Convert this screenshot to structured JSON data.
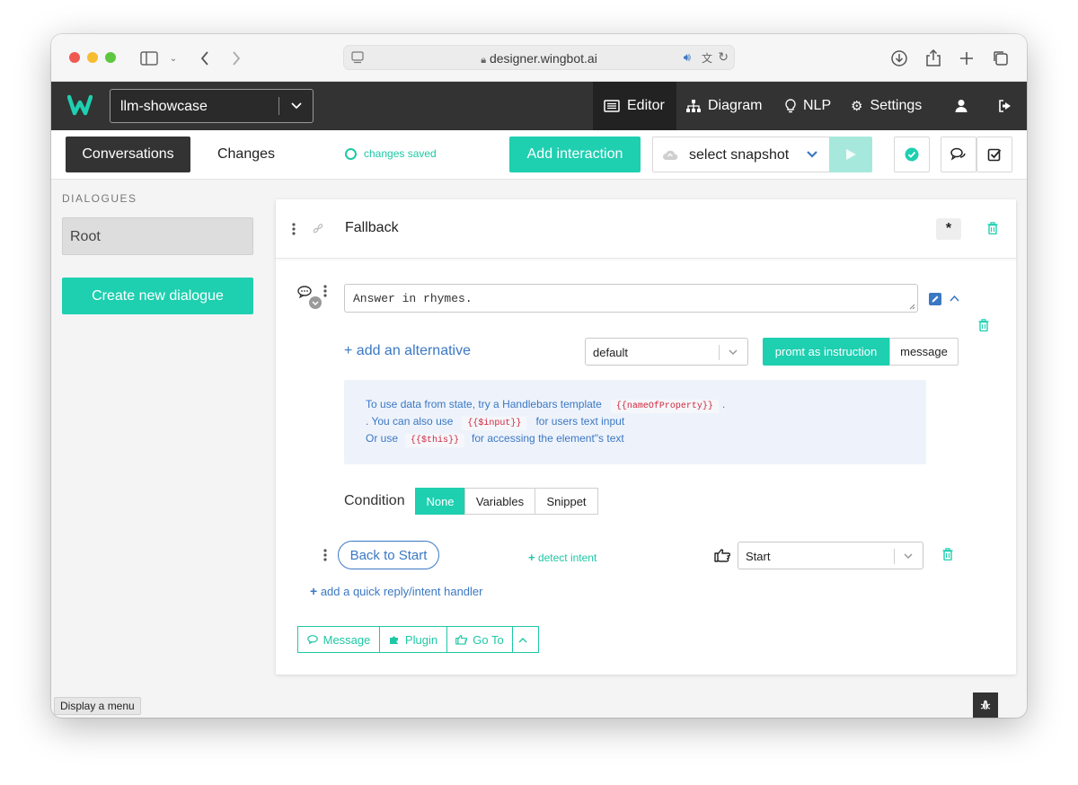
{
  "browser": {
    "url": "designer.wingbot.ai"
  },
  "appbar": {
    "project": "llm-showcase",
    "nav": [
      {
        "label": "Editor",
        "icon": "list-icon",
        "active": true
      },
      {
        "label": "Diagram",
        "icon": "sitemap-icon"
      },
      {
        "label": "NLP",
        "icon": "lightbulb-icon"
      },
      {
        "label": "Settings",
        "icon": "gears-icon"
      }
    ]
  },
  "toolbar": {
    "conversations": "Conversations",
    "changes": "Changes",
    "saved_status": "changes saved",
    "add_interaction": "Add interaction",
    "snapshot": "select snapshot"
  },
  "sidebar": {
    "title": "DIALOGUES",
    "root": "Root",
    "create": "Create new dialogue"
  },
  "interaction": {
    "title": "Fallback",
    "star": "*",
    "message_text": "Answer in rhymes.",
    "add_alternative": "+ add an alternative",
    "type_select": "default",
    "mode_instruction": "promt as instruction",
    "mode_message": "message",
    "info": {
      "line1_a": "To use data from state, try a Handlebars template",
      "line1_code": "{{nameOfProperty}}",
      "line1_b": ".",
      "line2_a": ". You can also use",
      "line2_code": "{{$input}}",
      "line2_b": "for users text input",
      "line3_a": "Or use",
      "line3_code": "{{$this}}",
      "line3_b": "for accessing the element\"s text"
    },
    "condition_label": "Condition",
    "condition_options": [
      "None",
      "Variables",
      "Snippet"
    ],
    "quick_reply": "Back to Start",
    "detect_intent": "detect intent",
    "goto_target": "Start",
    "add_quick_reply": "add a quick reply/intent handler",
    "bottom_buttons": {
      "message": "Message",
      "plugin": "Plugin",
      "goto": "Go To"
    }
  },
  "statusbar": {
    "text": "Display a menu"
  },
  "colors": {
    "accent": "#1ecfb0",
    "link": "#3b78c4",
    "dark": "#333333"
  }
}
